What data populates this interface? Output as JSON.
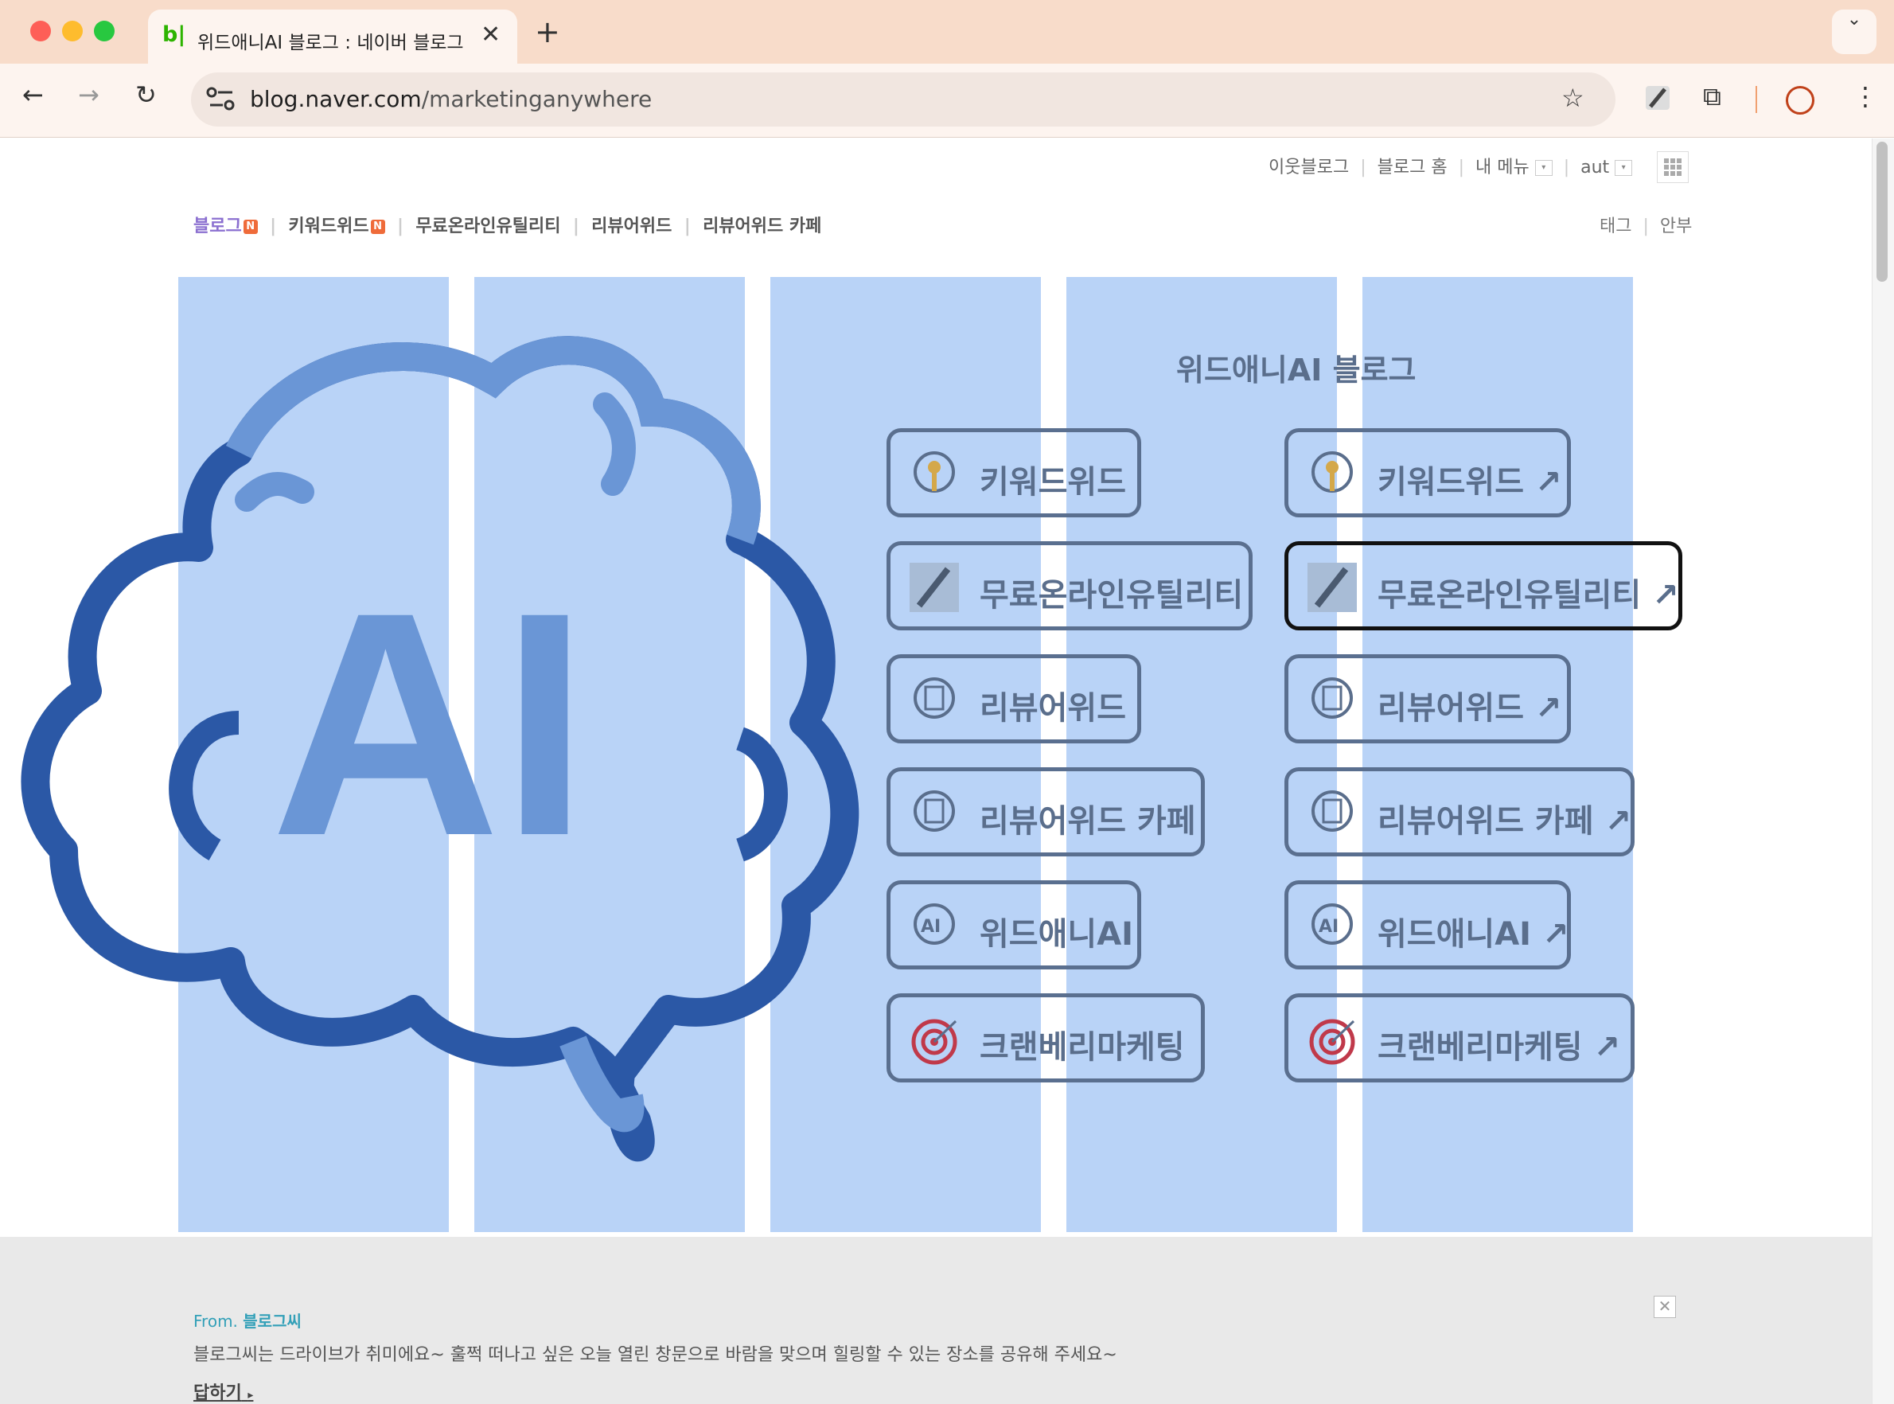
{
  "browser": {
    "tab_favicon": "b|",
    "tab_title": "위드애니AI 블로그 : 네이버 블로그",
    "url_host": "blog.naver.com",
    "url_path": "/marketinganywhere"
  },
  "gnb": {
    "neighbor_blog": "이웃블로그",
    "blog_home": "블로그 홈",
    "my_menu": "내 메뉴",
    "user": "aut"
  },
  "blog_menu": {
    "items": [
      "블로그",
      "키워드위드",
      "무료온라인유틸리티",
      "리뷰어위드",
      "리뷰어위드 카페"
    ],
    "tag": "태그",
    "guestbook": "안부"
  },
  "header": {
    "logo_text": "AI",
    "title": "위드애니AI 블로그",
    "left_buttons": [
      "키워드위드",
      "무료온라인유틸리티",
      "리뷰어위드",
      "리뷰어위드 카페",
      "위드애니AI",
      "크랜베리마케팅"
    ],
    "right_buttons": [
      "키워드위드 ↗",
      "무료온라인유틸리티 ↗",
      "리뷰어위드 ↗",
      "리뷰어위드 카페 ↗",
      "위드애니AI ↗",
      "크랜베리마케팅 ↗"
    ],
    "icons": [
      "key-brain-icon",
      "wrench-icon",
      "document-brain-icon",
      "document-brain-icon",
      "ai-brain-icon",
      "target-icon"
    ]
  },
  "banner": {
    "from_label": "From.",
    "from_name": "블로그씨",
    "text": "블로그씨는 드라이브가 취미에요~ 훌쩍 떠나고 싶은 오늘 열린 창문으로 바람을 맞으며 힐링할 수 있는 장소를 공유해 주세요~",
    "reply": "답하기"
  },
  "colors": {
    "tabbar": "#f8dcca",
    "toolbar": "#fdf4ef",
    "overlay_columns": "#b9d3f7",
    "brain_dark": "#2b58a6",
    "brain_light": "#6a96d6",
    "button_text": "#5a6e8c",
    "naver_green": "#2db400",
    "menu_active": "#8b6fd0"
  }
}
